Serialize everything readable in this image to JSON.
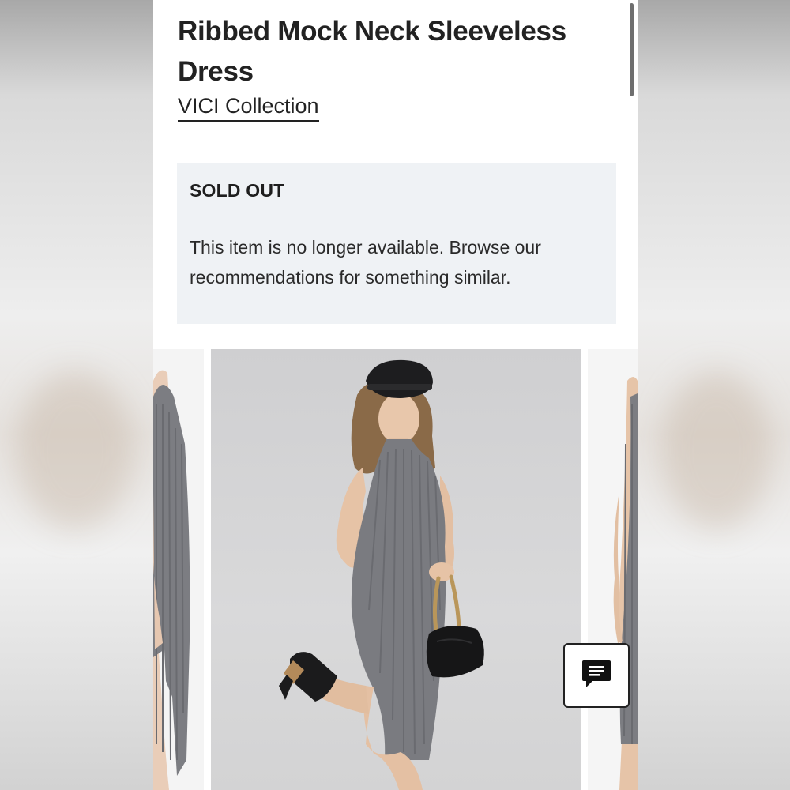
{
  "product": {
    "title": "Ribbed Mock Neck Sleeveless Dress",
    "brand": "VICI Collection"
  },
  "availability": {
    "heading": "SOLD OUT",
    "message": "This item is no longer available. Browse our recommendations for something similar."
  },
  "gallery": {
    "images": [
      {
        "name": "dress-side-view-partial"
      },
      {
        "name": "dress-model-full-view"
      },
      {
        "name": "dress-back-view-partial"
      }
    ]
  },
  "icons": {
    "chat": "chat-icon"
  },
  "colors": {
    "text": "#222222",
    "notice_bg": "#eff2f5",
    "dress_gray": "#7a7b80"
  }
}
